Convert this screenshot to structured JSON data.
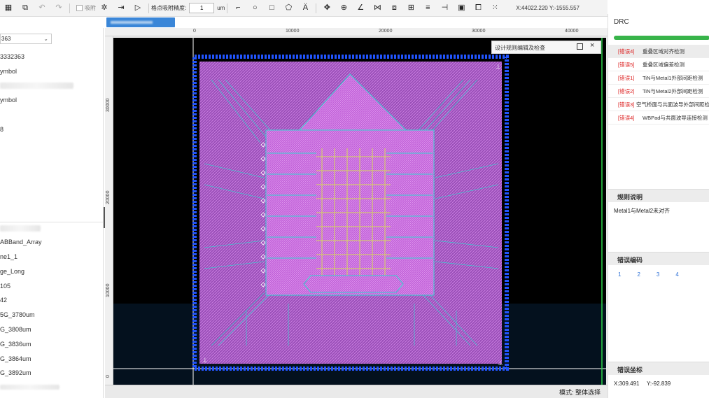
{
  "toolbar": {
    "snap_label": "吸附",
    "grid_snap_label": "格点吸附精度:",
    "grid_snap_value": "1",
    "grid_snap_unit": "um",
    "coords": "X:44022.220  Y:-1555.557"
  },
  "left_panel": {
    "dropdown_value": "363",
    "rows_top": [
      "3332363",
      "ymbol",
      "ymbol",
      "8"
    ],
    "rows_bottom": [
      "ABBand_Array",
      "ne1_1",
      "ge_Long",
      "105",
      "42",
      "5G_3780um",
      "G_3808um",
      "G_3836um",
      "G_3864um",
      "G_3892um"
    ]
  },
  "canvas": {
    "ruler_top": [
      "0",
      "10000",
      "20000",
      "30000",
      "40000"
    ],
    "ruler_left": [
      "30000",
      "20000",
      "10000",
      "0"
    ],
    "dialog_title": "设计规则编辑及检查",
    "status": "模式: 整体选择"
  },
  "drc": {
    "title": "DRC",
    "progress": 1.0,
    "errors": [
      {
        "code": "[错误4]",
        "desc": "重叠区域对齐检测"
      },
      {
        "code": "[错误5]",
        "desc": "重叠区域偏差检测"
      },
      {
        "code": "[错误1]",
        "desc": "TiN与Metal1外部间距检测"
      },
      {
        "code": "[错误2]",
        "desc": "TiN与Metal2外部间距检测"
      },
      {
        "code": "[错误3]",
        "desc": "空气桥面与共面波导外部间距检"
      },
      {
        "code": "[错误4]",
        "desc": "WBPad与共面波导连接检测"
      }
    ],
    "rule_header": "规则说明",
    "rule_text": "Metal1与Metal2未对齐",
    "code_header": "错误编码",
    "codes": [
      "1",
      "2",
      "3",
      "4"
    ],
    "coord_header": "错误坐标",
    "coord_x": "X:309.491",
    "coord_y": "Y:-92.839"
  },
  "colors": {
    "accent": "#3a86d8",
    "error_code": "#dd2222",
    "progress": "#38b44a",
    "chip_fill": "#b45cc8",
    "trace": "#35d0d0",
    "pad": "#2255ff"
  }
}
